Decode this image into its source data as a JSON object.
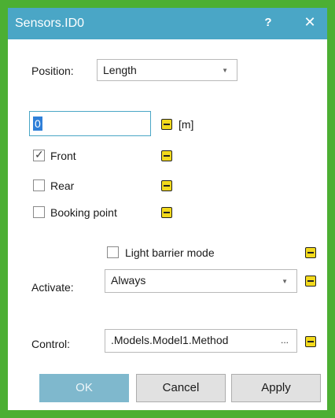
{
  "window": {
    "title": "Sensors.ID0",
    "help_label": "?",
    "close_label": "✕"
  },
  "position": {
    "label": "Position:",
    "selected": "Length"
  },
  "value_field": {
    "value": "0",
    "unit": "[m]"
  },
  "checkboxes": {
    "front": {
      "label": "Front",
      "checked": true
    },
    "rear": {
      "label": "Rear",
      "checked": false
    },
    "booking_point": {
      "label": "Booking point",
      "checked": false
    },
    "light_barrier": {
      "label": "Light barrier mode",
      "checked": false
    }
  },
  "activate": {
    "label": "Activate:",
    "selected": "Always"
  },
  "control": {
    "label": "Control:",
    "value": ".Models.Model1.Method",
    "ellipsis": "..."
  },
  "buttons": {
    "ok": "OK",
    "cancel": "Cancel",
    "apply": "Apply"
  },
  "colors": {
    "frame": "#4caf33",
    "titlebar": "#4aa6c6",
    "minus_icon": "#f2d91c"
  }
}
